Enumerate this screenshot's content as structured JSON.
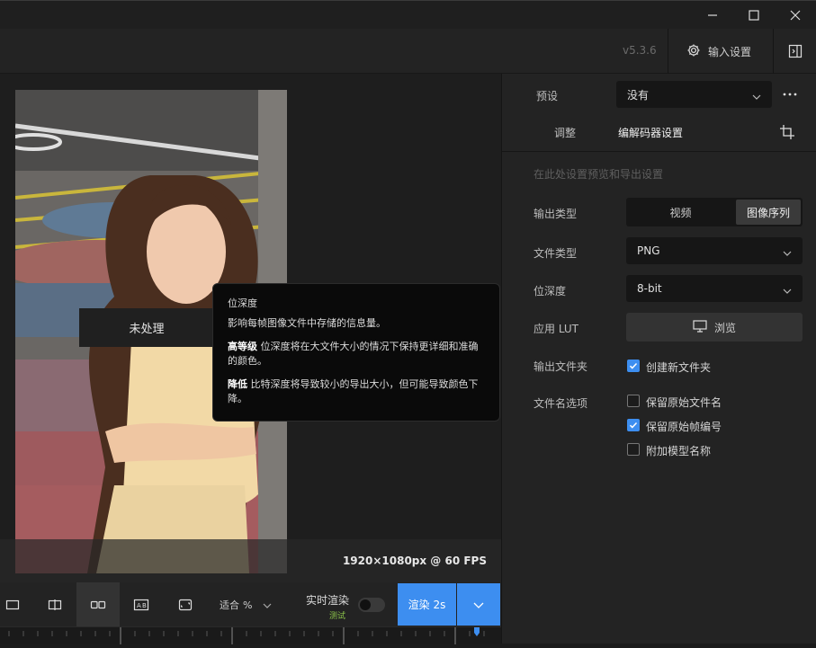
{
  "window": {
    "minimize_icon": "minimize-icon",
    "maximize_icon": "maximize-icon",
    "close_icon": "close-icon"
  },
  "toolbar": {
    "version": "v5.3.6",
    "input_settings_label": "输入设置",
    "input_settings_icon": "gear-icon",
    "panel_toggle_icon": "panel-toggle-icon"
  },
  "preview": {
    "unprocessed_label": "未处理",
    "resolution": "1920×1080px @ 60 FPS"
  },
  "tooltip": {
    "title": "位深度",
    "description": "影响每帧图像文件中存储的信息量。",
    "higher_term": "高等级",
    "higher_text": " 位深度将在大文件大小的情况下保持更详细和准确的颜色。",
    "lower_term": "降低",
    "lower_text": " 比特深度将导致较小的导出大小，但可能导致颜色下降。"
  },
  "bottombar": {
    "fit_label": "适合",
    "fit_unit": "%",
    "realtime_label": "实时渲染",
    "realtime_sub": "测试",
    "render_label": "渲染 2s"
  },
  "settings": {
    "preset_label": "预设",
    "preset_value": "没有",
    "tab_adjust": "调整",
    "tab_codec": "编解码器设置",
    "hint": "在此处设置预览和导出设置",
    "output_type_label": "输出类型",
    "output_type_options": [
      "视频",
      "图像序列"
    ],
    "output_type_selected": "图像序列",
    "file_type_label": "文件类型",
    "file_type_value": "PNG",
    "bit_depth_label": "位深度",
    "bit_depth_value": "8-bit",
    "lut_label": "应用 LUT",
    "lut_button": "浏览",
    "output_folder_label": "输出文件夹",
    "create_folder_label": "创建新文件夹",
    "create_folder_checked": true,
    "filename_label": "文件名选项",
    "filename_options": [
      {
        "label": "保留原始文件名",
        "checked": false
      },
      {
        "label": "保留原始帧编号",
        "checked": true
      },
      {
        "label": "附加模型名称",
        "checked": false
      }
    ]
  },
  "colors": {
    "accent": "#3d8ef0",
    "panel": "#232323",
    "tooltip_bg": "#0a0a0a"
  }
}
